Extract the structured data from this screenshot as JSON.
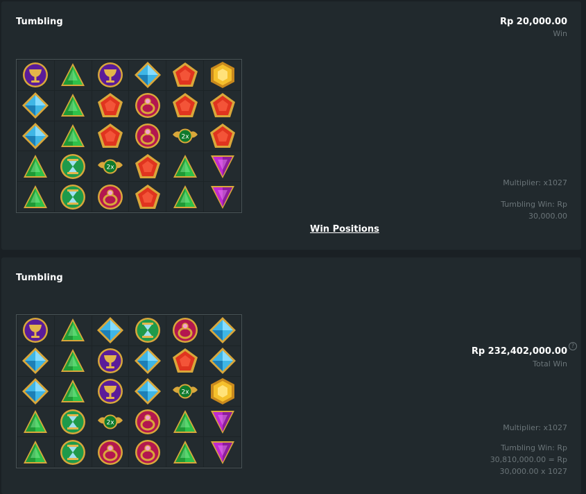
{
  "rounds": [
    {
      "title": "Tumbling",
      "win_amount": "Rp 20,000.00",
      "win_label": "Win",
      "multiplier_text": "Multiplier: x1027",
      "tumbling_win_line1": "Tumbling Win: Rp",
      "tumbling_win_line2": "30,000.00",
      "link_label": "Win Positions",
      "grid": [
        [
          "chalice",
          "green-triangle",
          "chalice",
          "blue-diamond",
          "red-pentagon",
          "gold-hexagon"
        ],
        [
          "blue-diamond",
          "green-triangle",
          "red-pentagon",
          "ring",
          "red-pentagon",
          "red-pentagon"
        ],
        [
          "blue-diamond",
          "green-triangle",
          "red-pentagon",
          "ring",
          "multiplier",
          "red-pentagon"
        ],
        [
          "green-triangle",
          "hourglass",
          "multiplier",
          "red-pentagon",
          "green-triangle",
          "purple-triangle"
        ],
        [
          "green-triangle",
          "hourglass",
          "ring",
          "red-pentagon",
          "green-triangle",
          "purple-triangle"
        ]
      ]
    },
    {
      "title": "Tumbling",
      "total_amount": "Rp 232,402,000.00",
      "total_label": "Total Win",
      "help_glyph": "?",
      "multiplier_text": "Multiplier: x1027",
      "tumbling_win_line1": "Tumbling Win: Rp",
      "tumbling_win_line2": "30,810,000.00 = Rp",
      "tumbling_win_line3": "30,000.00 x 1027",
      "grid": [
        [
          "chalice",
          "green-triangle",
          "blue-diamond",
          "hourglass",
          "ring",
          "blue-diamond"
        ],
        [
          "blue-diamond",
          "green-triangle",
          "chalice",
          "blue-diamond",
          "red-pentagon",
          "blue-diamond"
        ],
        [
          "blue-diamond",
          "green-triangle",
          "chalice",
          "blue-diamond",
          "multiplier",
          "gold-hexagon"
        ],
        [
          "green-triangle",
          "hourglass",
          "multiplier",
          "ring",
          "green-triangle",
          "purple-triangle"
        ],
        [
          "green-triangle",
          "hourglass",
          "ring",
          "ring",
          "green-triangle",
          "purple-triangle"
        ]
      ]
    }
  ],
  "multiplier_badge": "2x",
  "colors": {
    "panel_bg": "#21292d",
    "page_bg": "#1a2024",
    "muted_text": "#6b7579",
    "gold": "#d9a73a",
    "green_gem": "#2fc14a",
    "blue_gem": "#3fb6e6",
    "red_gem": "#e0341f",
    "purple_gem": "#c02ad0",
    "ring_bg": "#b3174f",
    "chalice_bg": "#5a1c9a",
    "hourglass_bg": "#1f9a4a"
  }
}
